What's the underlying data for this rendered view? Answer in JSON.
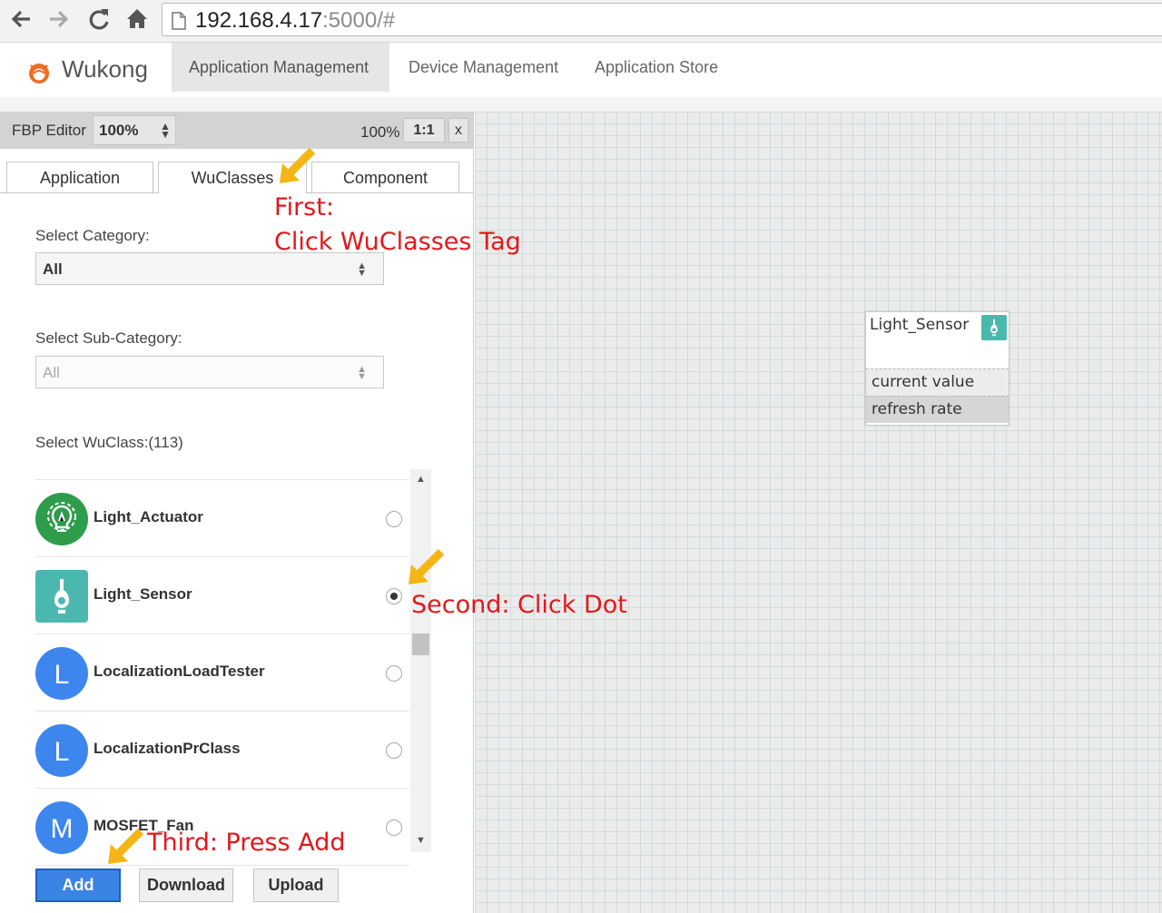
{
  "browser": {
    "url_host": "192.168.4.17",
    "url_rest": ":5000/#"
  },
  "header": {
    "brand": "Wukong",
    "menu": [
      {
        "label": "Application Management",
        "active": true
      },
      {
        "label": "Device Management",
        "active": false
      },
      {
        "label": "Application Store",
        "active": false
      }
    ]
  },
  "editor_toolbar": {
    "label": "FBP Editor",
    "zoom_value": "100%",
    "zoom_readout": "100%",
    "reset_label": "1:1",
    "close_label": "x"
  },
  "tabs": [
    {
      "label": "Application",
      "active": false
    },
    {
      "label": "WuClasses",
      "active": true
    },
    {
      "label": "Component",
      "active": false
    }
  ],
  "form": {
    "category_label": "Select Category:",
    "category_value": "All",
    "subcategory_label": "Select Sub-Category:",
    "subcategory_value": "All",
    "wuclass_label": "Select WuClass:(113)"
  },
  "wuclasses": [
    {
      "name": "Light_Actuator",
      "icon": "light-actuator-icon",
      "selected": false
    },
    {
      "name": "Light_Sensor",
      "icon": "light-sensor-icon",
      "selected": true
    },
    {
      "name": "LocalizationLoadTester",
      "icon": "letter-l-icon",
      "letter": "L",
      "selected": false
    },
    {
      "name": "LocalizationPrClass",
      "icon": "letter-l-icon",
      "letter": "L",
      "selected": false
    },
    {
      "name": "MOSFET_Fan",
      "icon": "letter-m-icon",
      "letter": "M",
      "selected": false
    }
  ],
  "buttons": {
    "add": "Add",
    "download": "Download",
    "upload": "Upload"
  },
  "canvas_node": {
    "title": "Light_Sensor",
    "properties": [
      "current value",
      "refresh rate"
    ]
  },
  "annotations": {
    "first_line1": "First:",
    "first_line2": "Click WuClasses Tag",
    "second": "Second: Click Dot",
    "third": "Third: Press Add"
  },
  "colors": {
    "primary_button": "#3b84e3",
    "annotation_text": "#e3171b",
    "annotation_arrow": "#f5b515",
    "light_actuator": "#2f9c4b",
    "light_sensor": "#4bb8b0",
    "letter_icon": "#3d86ee"
  }
}
